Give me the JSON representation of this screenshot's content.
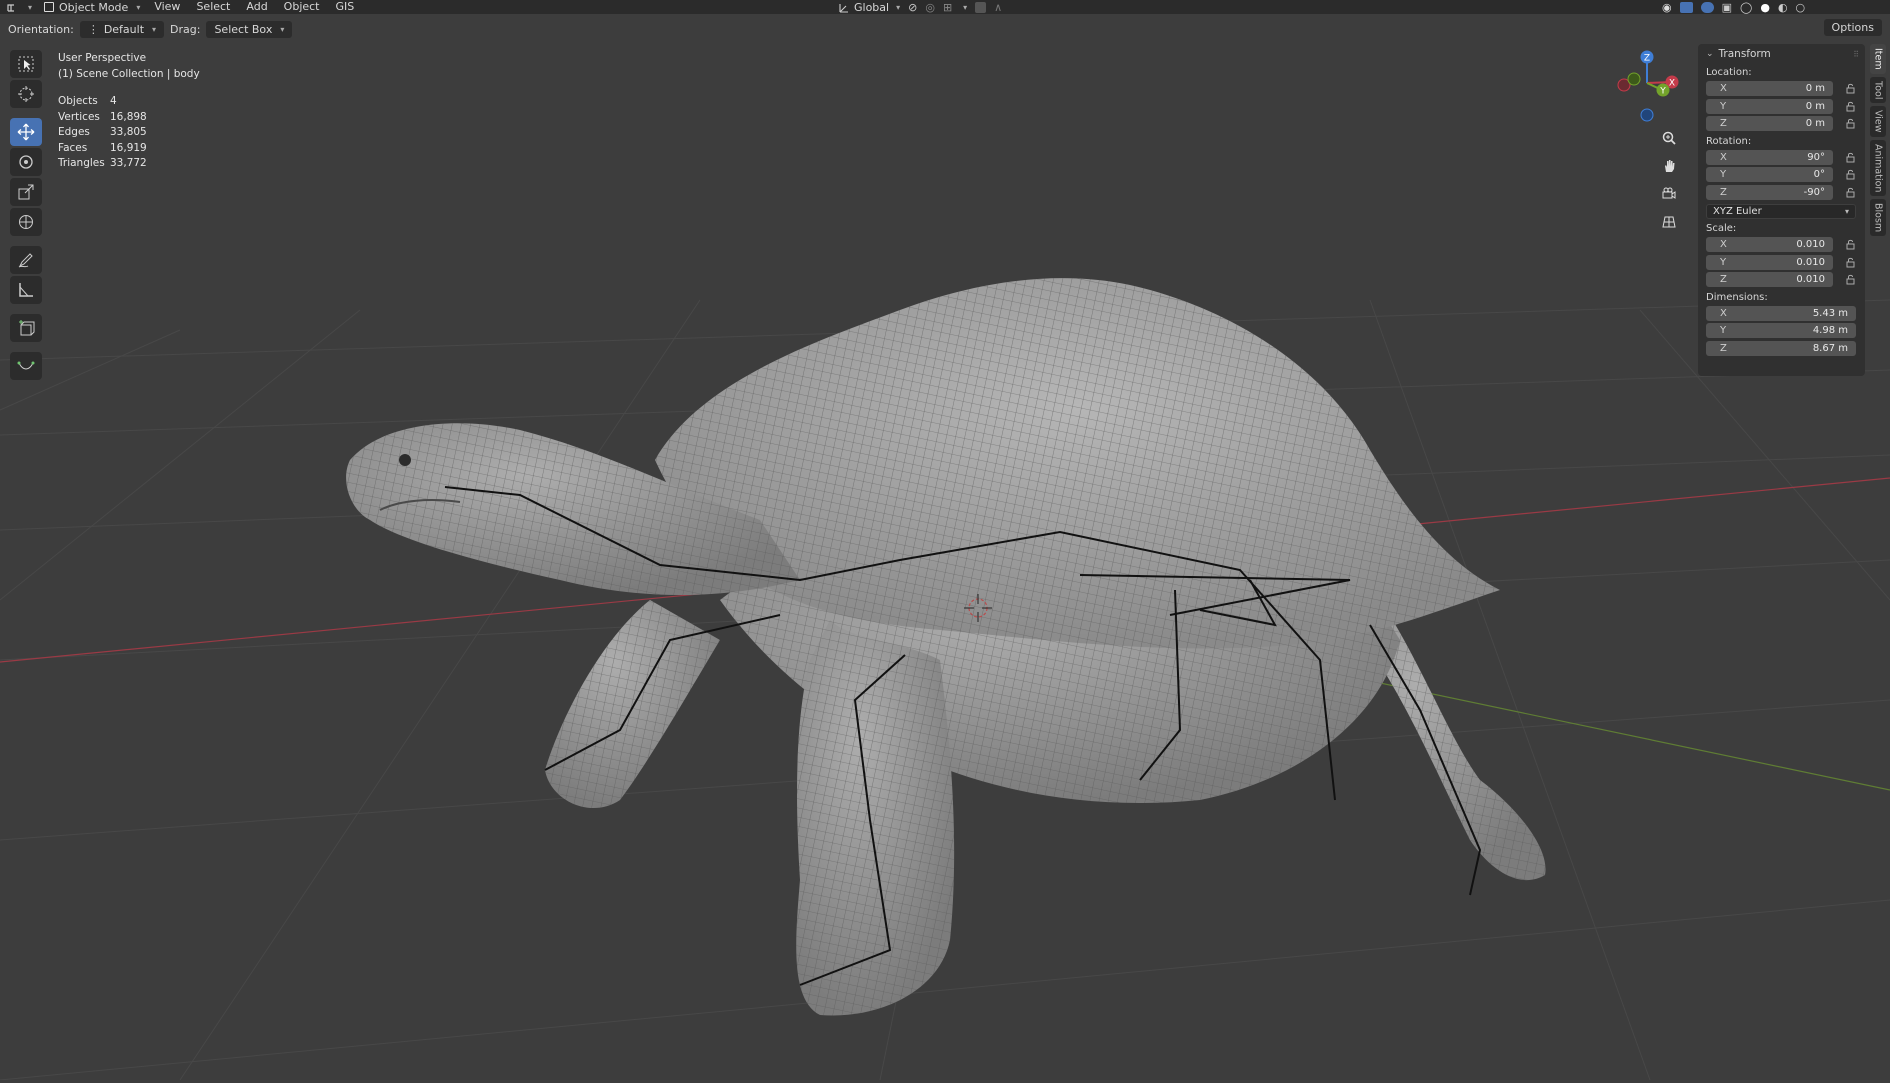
{
  "header": {
    "mode_label": "Object Mode",
    "menus": [
      "View",
      "Select",
      "Add",
      "Object",
      "GIS"
    ],
    "transform_orientation": "Global"
  },
  "tool_settings": {
    "orientation_label": "Orientation:",
    "orientation_value": "Default",
    "drag_label": "Drag:",
    "drag_value": "Select Box",
    "options_label": "Options"
  },
  "viewport": {
    "view_name": "User Perspective",
    "collection": "(1) Scene Collection | body",
    "stats": [
      {
        "label": "Objects",
        "value": "4"
      },
      {
        "label": "Vertices",
        "value": "16,898"
      },
      {
        "label": "Edges",
        "value": "33,805"
      },
      {
        "label": "Faces",
        "value": "16,919"
      },
      {
        "label": "Triangles",
        "value": "33,772"
      }
    ],
    "gizmo": {
      "x": "X",
      "y": "Y",
      "z": "Z"
    }
  },
  "npanel": {
    "title": "Transform",
    "location_label": "Location:",
    "location": [
      {
        "axis": "X",
        "value": "0 m"
      },
      {
        "axis": "Y",
        "value": "0 m"
      },
      {
        "axis": "Z",
        "value": "0 m"
      }
    ],
    "rotation_label": "Rotation:",
    "rotation": [
      {
        "axis": "X",
        "value": "90°"
      },
      {
        "axis": "Y",
        "value": "0°"
      },
      {
        "axis": "Z",
        "value": "-90°"
      }
    ],
    "rotation_mode": "XYZ Euler",
    "scale_label": "Scale:",
    "scale": [
      {
        "axis": "X",
        "value": "0.010"
      },
      {
        "axis": "Y",
        "value": "0.010"
      },
      {
        "axis": "Z",
        "value": "0.010"
      }
    ],
    "dimensions_label": "Dimensions:",
    "dimensions": [
      {
        "axis": "X",
        "value": "5.43 m"
      },
      {
        "axis": "Y",
        "value": "4.98 m"
      },
      {
        "axis": "Z",
        "value": "8.67 m"
      }
    ]
  },
  "side_tabs": [
    "Item",
    "Tool",
    "View",
    "Animation",
    "Blosm"
  ],
  "colors": {
    "accent": "#4772b3",
    "x_axis": "#c43b4a",
    "y_axis": "#73a32b",
    "z_axis": "#3f7ed6"
  }
}
